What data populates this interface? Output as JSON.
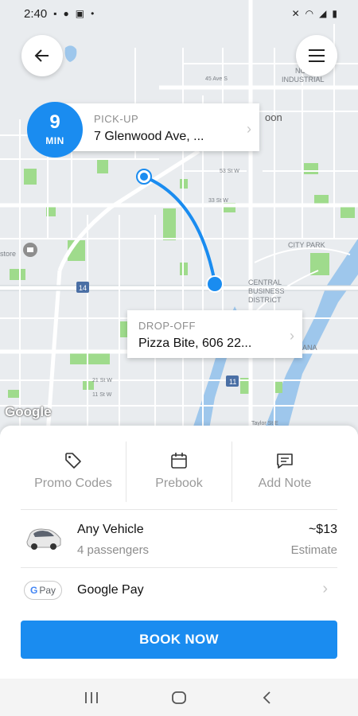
{
  "status_bar": {
    "time": "2:40",
    "left_icons": [
      "sim-icon",
      "location-icon",
      "image-icon",
      "dot-icon"
    ],
    "right_icons": [
      "mute-icon",
      "wifi-icon",
      "signal-icon",
      "battery-icon"
    ]
  },
  "map": {
    "google_label": "Google",
    "street_labels": {
      "ave_45": "45 Ave S",
      "north_industrial_1": "NO",
      "north_industrial_2": "INDUSTRIAL",
      "saskatoon": "oon",
      "st_53w": "53 St W",
      "st_33w": "33 St W",
      "city_park": "CITY PARK",
      "central_1": "CENTRAL",
      "central_2": "BUSINESS",
      "central_3": "DISTRICT",
      "hwy_14": "14",
      "hwy_11": "11",
      "store": "store",
      "st_21w": "21 St W",
      "st_11w": "11 St W",
      "ana": "ANA",
      "taylor": "Taylor St E"
    },
    "colors": {
      "land": "#e9ecef",
      "road": "#ffffff",
      "park": "#9fdb8c",
      "water": "#9ec7ec",
      "route": "#1a8cf0"
    }
  },
  "back_button": {
    "icon": "arrow-left-icon"
  },
  "menu_button": {
    "icon": "hamburger-icon"
  },
  "eta": {
    "value": "9",
    "unit": "MIN"
  },
  "pickup": {
    "label": "PICK-UP",
    "address": "7 Glenwood Ave, ..."
  },
  "dropoff": {
    "label": "DROP-OFF",
    "address": "Pizza Bite, 606 22..."
  },
  "actions": [
    {
      "label": "Promo Codes",
      "icon": "tag-icon"
    },
    {
      "label": "Prebook",
      "icon": "calendar-icon"
    },
    {
      "label": "Add Note",
      "icon": "note-icon"
    }
  ],
  "vehicle": {
    "name": "Any Vehicle",
    "passengers": "4 passengers",
    "price": "~$13",
    "price_note": "Estimate"
  },
  "payment": {
    "badge": "Pay",
    "method": "Google Pay"
  },
  "book_button": {
    "label": "BOOK NOW"
  },
  "nav": {
    "items": [
      "recent-apps-icon",
      "home-icon",
      "back-icon"
    ]
  }
}
